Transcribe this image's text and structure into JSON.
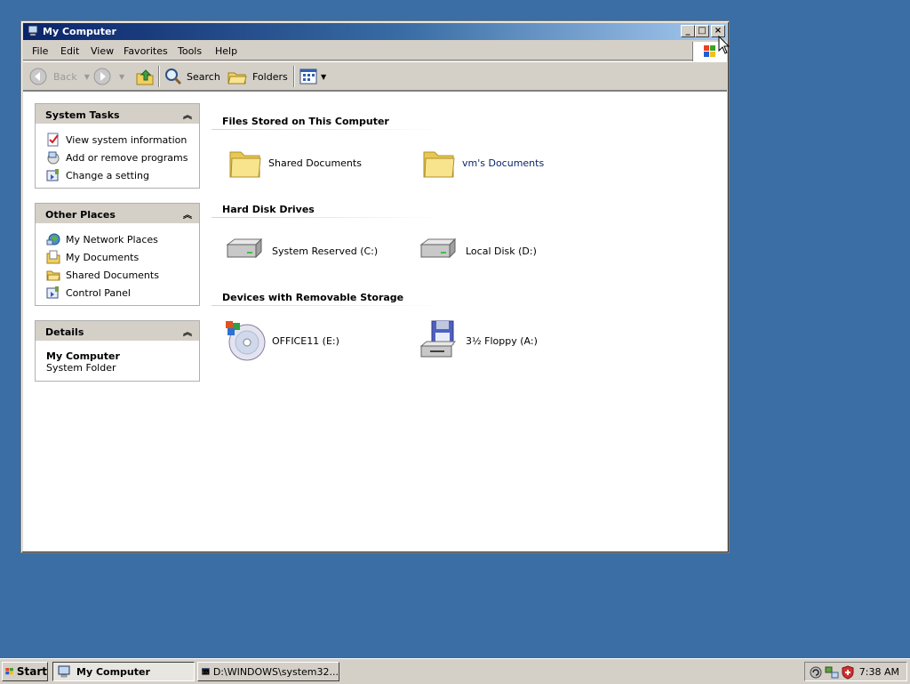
{
  "window": {
    "title": "My Computer",
    "controls": {
      "minimize": "_",
      "maximize": "□",
      "close": "×"
    }
  },
  "menubar": {
    "items": [
      "File",
      "Edit",
      "View",
      "Favorites",
      "Tools",
      "Help"
    ]
  },
  "toolbar": {
    "back_label": "Back",
    "search_label": "Search",
    "folders_label": "Folders"
  },
  "taskpane": {
    "system_tasks": {
      "title": "System Tasks",
      "items": [
        "View system information",
        "Add or remove programs",
        "Change a setting"
      ]
    },
    "other_places": {
      "title": "Other Places",
      "items": [
        "My Network Places",
        "My Documents",
        "Shared Documents",
        "Control Panel"
      ]
    },
    "details": {
      "title": "Details",
      "name": "My Computer",
      "type": "System Folder"
    }
  },
  "groups": [
    {
      "title": "Files Stored on This Computer",
      "items": [
        "Shared Documents",
        "vm's Documents"
      ]
    },
    {
      "title": "Hard Disk Drives",
      "items": [
        "System Reserved (C:)",
        "Local Disk (D:)"
      ]
    },
    {
      "title": "Devices with Removable Storage",
      "items": [
        "OFFICE11 (E:)",
        "3½ Floppy (A:)"
      ]
    }
  ],
  "taskbar": {
    "start_label": "Start",
    "tasks": [
      "My Computer",
      "D:\\WINDOWS\\system32..."
    ],
    "clock": "7:38 AM"
  },
  "colors": {
    "desktop": "#3a6ea5",
    "titlebar_start": "#0a246a",
    "link": "#0a246a"
  }
}
